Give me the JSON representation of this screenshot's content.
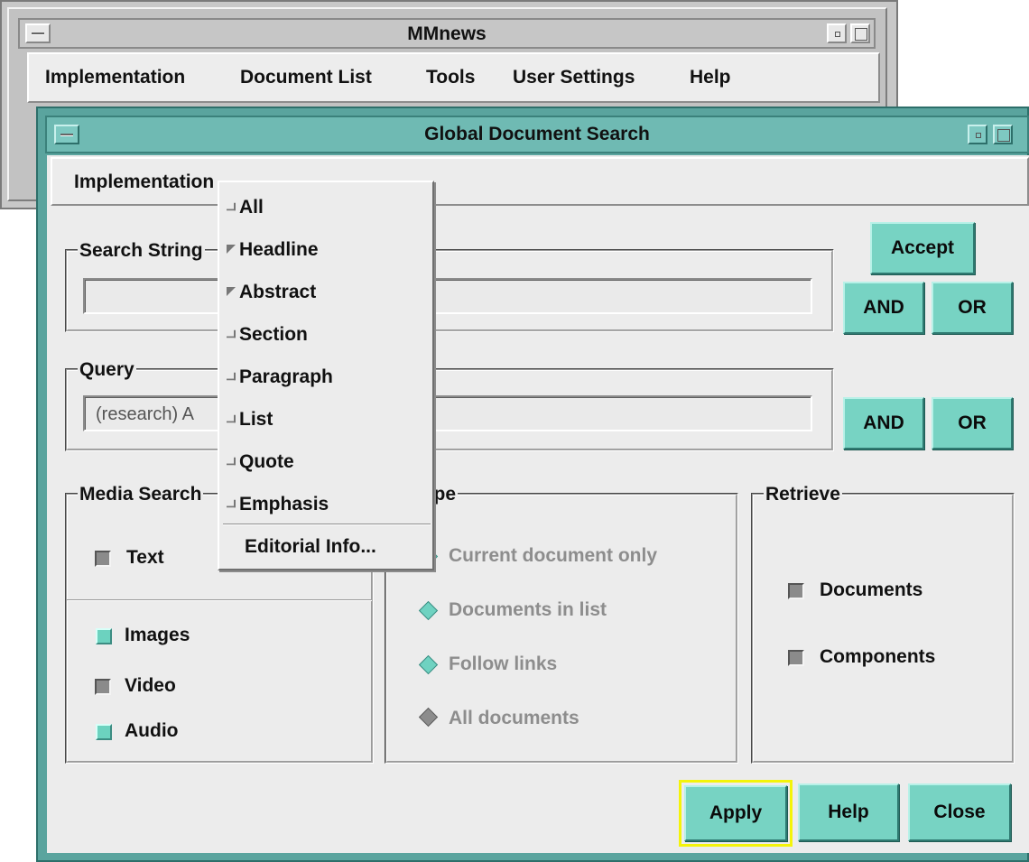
{
  "background_window": {
    "title": "MMnews",
    "menu": [
      "Implementation",
      "Document List",
      "Tools",
      "User Settings",
      "Help"
    ]
  },
  "dialog": {
    "title": "Global Document Search",
    "menu": [
      "Implementation"
    ],
    "search_string": {
      "label": "Search String",
      "value": ""
    },
    "query": {
      "label": "Query",
      "value": "(research) A"
    },
    "accept_label": "Accept",
    "and_label": "AND",
    "or_label": "OR",
    "media": {
      "label": "Media Search",
      "items": [
        {
          "label": "Text",
          "checked": true
        },
        {
          "label": "Images",
          "checked": false
        },
        {
          "label": "Video",
          "checked": true
        },
        {
          "label": "Audio",
          "checked": false
        }
      ]
    },
    "scope": {
      "label": "Scope",
      "options": [
        {
          "label": "Current document only",
          "selected": false
        },
        {
          "label": "Documents in list",
          "selected": false
        },
        {
          "label": "Follow links",
          "selected": false
        },
        {
          "label": "All documents",
          "selected": true
        }
      ]
    },
    "retrieve": {
      "label": "Retrieve",
      "items": [
        {
          "label": "Documents",
          "checked": true
        },
        {
          "label": "Components",
          "checked": true
        }
      ]
    },
    "buttons": {
      "apply": "Apply",
      "help": "Help",
      "close": "Close"
    }
  },
  "dropdown": {
    "items": [
      {
        "label": "All",
        "checked": false
      },
      {
        "label": "Headline",
        "checked": true
      },
      {
        "label": "Abstract",
        "checked": true
      },
      {
        "label": "Section",
        "checked": false
      },
      {
        "label": "Paragraph",
        "checked": false
      },
      {
        "label": "List",
        "checked": false
      },
      {
        "label": "Quote",
        "checked": false
      },
      {
        "label": "Emphasis",
        "checked": false
      }
    ],
    "editorial": "Editorial Info..."
  },
  "colors": {
    "accent": "#77d3c3",
    "window_frame": "#5aa49e",
    "focus": "#f4f40a"
  }
}
